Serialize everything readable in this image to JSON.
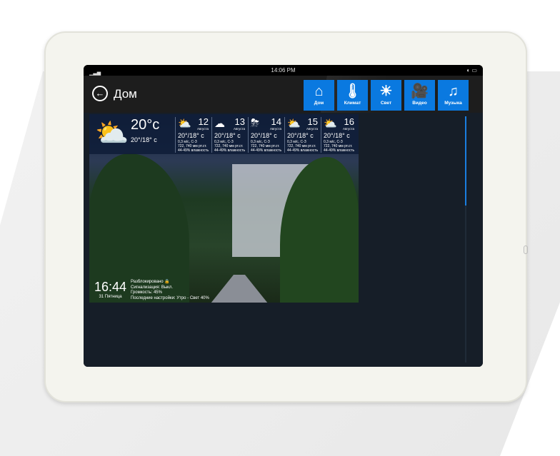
{
  "status_bar": {
    "time": "14:06 PM",
    "signal": "▁▃▅",
    "battery": "◐ ▭"
  },
  "header": {
    "title": "Дом",
    "back": "←"
  },
  "nav": [
    {
      "label": "Дом",
      "icon": "⌂"
    },
    {
      "label": "Климат",
      "icon": "🌡"
    },
    {
      "label": "Свет",
      "icon": "☀"
    },
    {
      "label": "Видео",
      "icon": "🎥"
    },
    {
      "label": "Музыка",
      "icon": "♫"
    }
  ],
  "weather": {
    "current": {
      "temp": "20°c",
      "range": "20°/18° c",
      "icon": "⛅"
    },
    "days": [
      {
        "day": "12",
        "month": "Августа",
        "icon": "⛅",
        "range": "20°/18° c",
        "wind": "0,3 м/с, С-З",
        "pressure": "722, 740 мм рт.ст.",
        "humidity": "44-49% влажность"
      },
      {
        "day": "13",
        "month": "Августа",
        "icon": "☁",
        "range": "20°/18° c",
        "wind": "0,3 м/с, С-З",
        "pressure": "722, 740 мм рт.ст.",
        "humidity": "44-49% влажность"
      },
      {
        "day": "14",
        "month": "Августа",
        "icon": "⛈",
        "range": "20°/18° c",
        "wind": "0,3 м/с, С-З",
        "pressure": "722, 740 мм рт.ст.",
        "humidity": "44-49% влажность"
      },
      {
        "day": "15",
        "month": "Августа",
        "icon": "⛅",
        "range": "20°/18° c",
        "wind": "0,3 м/с, С-З",
        "pressure": "722, 740 мм рт.ст.",
        "humidity": "44-49% влажность"
      },
      {
        "day": "16",
        "month": "Августа",
        "icon": "⛅",
        "range": "20°/18° c",
        "wind": "0,3 м/с, С-З",
        "pressure": "722, 740 мм рт.ст.",
        "humidity": "44-49% влажность"
      }
    ]
  },
  "clock": {
    "time": "16:44",
    "date": "31 Пятница"
  },
  "info": {
    "lock": "Разблокировано 🔒",
    "alarm": "Сигнализация: Выкл.",
    "volume": "Громкость: 45%",
    "settings": "Последние настройки: Утро - Свет 40%"
  },
  "colors": {
    "accent": "#0a79e0",
    "background": "#161e28"
  }
}
